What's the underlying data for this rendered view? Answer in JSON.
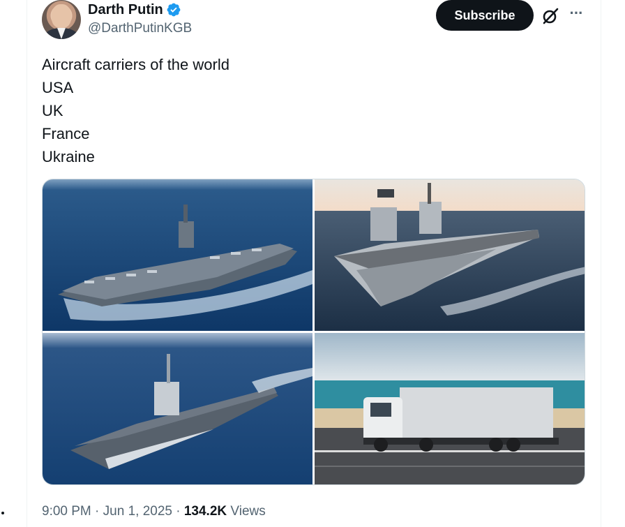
{
  "author": {
    "display_name": "Darth Putin",
    "handle": "@DarthPutinKGB",
    "verified": true,
    "avatar_icon": "avatar-photo"
  },
  "actions": {
    "subscribe_label": "Subscribe",
    "grok_icon": "grok-icon",
    "more_icon": "more-icon",
    "more_glyph": "···"
  },
  "tweet": {
    "lines": [
      "Aircraft carriers of the world",
      "USA",
      "UK",
      "France",
      "Ukraine"
    ]
  },
  "media": {
    "images": [
      {
        "subject": "aircraft-carrier-usa"
      },
      {
        "subject": "aircraft-carrier-uk"
      },
      {
        "subject": "aircraft-carrier-france"
      },
      {
        "subject": "semi-truck-on-road"
      }
    ]
  },
  "meta": {
    "time": "9:00 PM",
    "date": "Jun 1, 2025",
    "views_count": "134.2K",
    "views_label": "Views",
    "separator": "·"
  },
  "colors": {
    "text_primary": "#0f1419",
    "text_secondary": "#536471",
    "verified_blue": "#1d9bf0",
    "border": "#cfd9de"
  }
}
